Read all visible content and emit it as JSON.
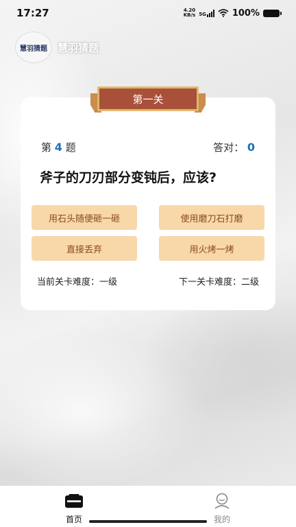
{
  "status": {
    "time": "17:27",
    "speed_value": "4.20",
    "speed_unit": "KB/s",
    "network": "5G",
    "battery": "100%"
  },
  "app": {
    "logo_text": "慧羽猜题",
    "title": "慧羽猜题"
  },
  "level": {
    "ribbon": "第一关"
  },
  "question": {
    "prefix": "第",
    "number": "4",
    "suffix": "题",
    "correct_label": "答对：",
    "correct_count": "0",
    "text": "斧子的刀刃部分变钝后，应该?"
  },
  "options": [
    "用石头随便砸一砸",
    "使用磨刀石打磨",
    "直接丢弃",
    "用火烤一烤"
  ],
  "difficulty": {
    "current": "当前关卡难度：一级",
    "next": "下一关卡难度：二级"
  },
  "tabs": [
    {
      "label": "首页",
      "icon": "home-icon",
      "active": true,
      "color": "#111111"
    },
    {
      "label": "我的",
      "icon": "user-icon",
      "active": false,
      "color": "#888888"
    }
  ],
  "colors": {
    "ribbon": "#a9503b",
    "option_bg": "#f8d7a9",
    "option_text": "#8a4b1a",
    "accent": "#1f6fb8"
  }
}
